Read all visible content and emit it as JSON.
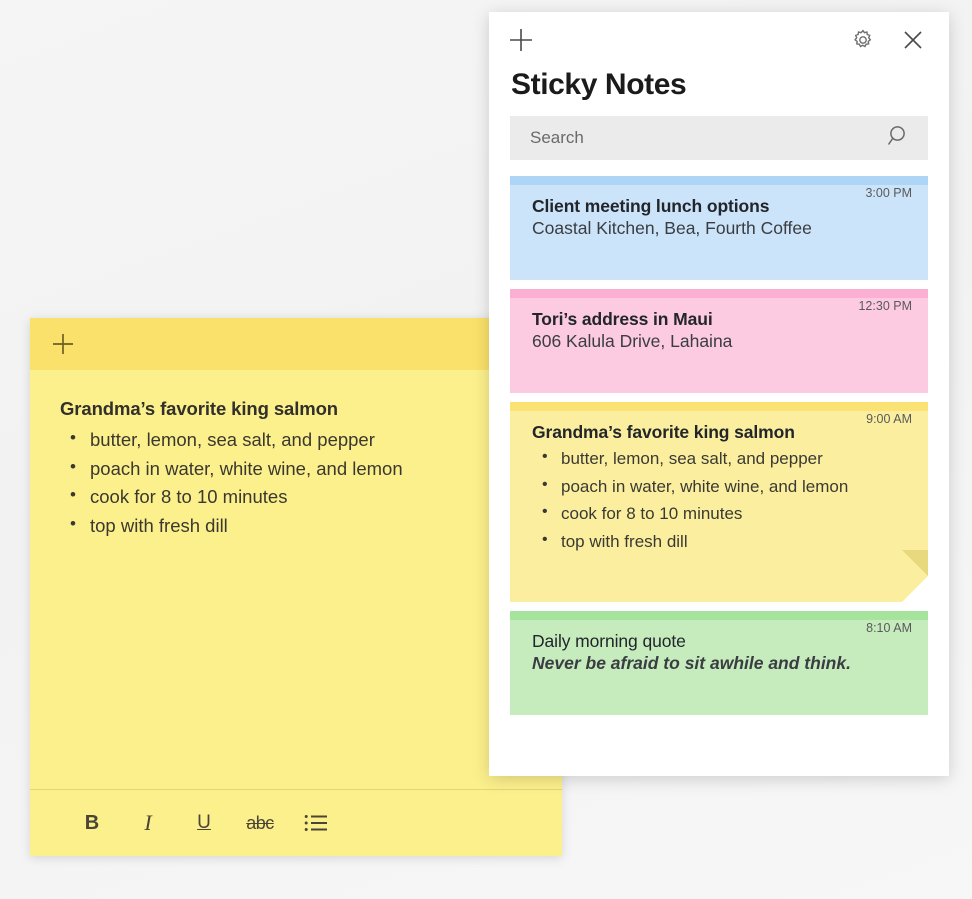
{
  "colors": {
    "app_background": "#f5f5f5",
    "panel_background": "#ffffff",
    "sticky_yellow_body": "#fcf08c",
    "sticky_yellow_titlebar": "#fae16b",
    "card_blue_body": "#cce4fa",
    "card_blue_strip": "#aed5f5",
    "card_pink_body": "#fccbe1",
    "card_pink_strip": "#fbafd2",
    "card_yellow_body": "#fbef9f",
    "card_yellow_strip": "#fae275",
    "card_green_body": "#c6ecbe",
    "card_green_strip": "#a6e39c",
    "search_background": "#ebebeb"
  },
  "sticky_note": {
    "add_icon": "plus-icon",
    "menu_icon": "more-options-icon",
    "menu_label": "··",
    "heading": "Grandma’s favorite king salmon",
    "bullets": [
      "butter, lemon, sea salt, and pepper",
      "poach in water, white wine, and lemon",
      "cook for 8 to 10 minutes",
      "top with fresh dill"
    ],
    "toolbar": {
      "bold_label": "B",
      "italic_label": "I",
      "underline_label": "U",
      "strikethrough_label": "abc",
      "bullets_icon": "bullet-list-icon"
    }
  },
  "panel": {
    "add_icon": "plus-icon",
    "settings_icon": "gear-icon",
    "close_icon": "close-icon",
    "title": "Sticky Notes",
    "search": {
      "placeholder": "Search",
      "value": "",
      "icon": "search-icon"
    },
    "notes": [
      {
        "color": "blue",
        "time": "3:00 PM",
        "title": "Client meeting lunch options",
        "subtitle": "Coastal Kitchen, Bea, Fourth Coffee",
        "bullets": [],
        "title_bold": true,
        "subtitle_italic": false,
        "folded_corner": false
      },
      {
        "color": "pink",
        "time": "12:30 PM",
        "title": "Tori’s address in Maui",
        "subtitle": "606 Kalula Drive, Lahaina",
        "bullets": [],
        "title_bold": true,
        "subtitle_italic": false,
        "folded_corner": false
      },
      {
        "color": "yellow",
        "time": "9:00 AM",
        "title": "Grandma’s favorite king salmon",
        "subtitle": "",
        "bullets": [
          "butter, lemon, sea salt, and pepper",
          "poach in water, white wine, and lemon",
          "cook for 8 to 10 minutes",
          "top with fresh dill"
        ],
        "title_bold": true,
        "subtitle_italic": false,
        "folded_corner": true
      },
      {
        "color": "green",
        "time": "8:10 AM",
        "title": "Daily morning quote",
        "subtitle": "Never be afraid to sit awhile and think.",
        "bullets": [],
        "title_bold": false,
        "subtitle_italic": true,
        "folded_corner": false
      }
    ]
  }
}
